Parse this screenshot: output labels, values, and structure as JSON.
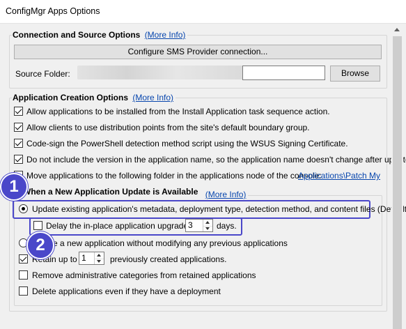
{
  "window": {
    "title": "ConfigMgr Apps Options"
  },
  "connection": {
    "title": "Connection and Source Options",
    "more_info": "(More Info)",
    "configure_button": "Configure SMS Provider connection...",
    "source_folder_label": "Source Folder:",
    "source_folder_value": "",
    "browse_button": "Browse"
  },
  "creation": {
    "title": "Application Creation Options",
    "more_info": "(More Info)",
    "options": [
      {
        "label": "Allow applications to be installed from the Install Application task sequence action.",
        "checked": true
      },
      {
        "label": "Allow clients to use distribution points from the site's default boundary group.",
        "checked": true
      },
      {
        "label": "Code-sign the PowerShell detection method script using the WSUS Signing Certificate.",
        "checked": true
      },
      {
        "label": "Do not include the version in the application name, so the application name doesn't change after updates.",
        "checked": true
      },
      {
        "label": "Move applications to the following folder in the applications node of the console:",
        "checked": false
      }
    ],
    "folder_link": "Applications\\Patch My"
  },
  "update": {
    "title": "When a New Application Update is Available",
    "more_info": "(More Info)",
    "update_existing_label": "Update existing application's metadata, deployment type, detection method, and content files (Default)",
    "update_existing_selected": true,
    "delay_label": "Delay the in-place application upgrade by",
    "delay_checked": false,
    "delay_value": "3",
    "delay_unit": "days.",
    "create_new_label": "e a new application without modifying any previous applications",
    "create_new_selected": false,
    "retain_label": "Retain up to",
    "retain_checked": true,
    "retain_value": "1",
    "retain_suffix": "previously created applications.",
    "remove_categories_label": "Remove administrative categories from retained applications",
    "remove_categories_checked": false,
    "delete_label": "Delete applications even if they have a deployment",
    "delete_checked": false
  },
  "annotations": {
    "badge1": "1",
    "badge2": "2",
    "accent": "#4a47c9"
  }
}
